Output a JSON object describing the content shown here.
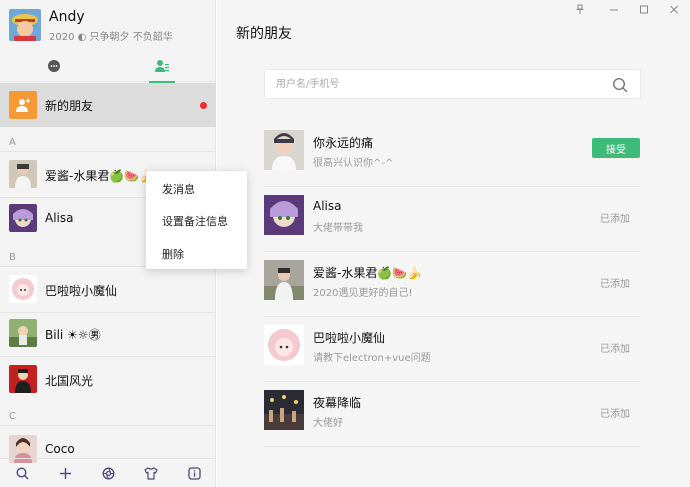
{
  "profile": {
    "name": "Andy",
    "subtitle": "2020 ◐ 只争朝夕 不负韶华"
  },
  "tabs": [
    {
      "icon": "chat-bubble-icon"
    },
    {
      "icon": "contacts-icon"
    }
  ],
  "new_friends": {
    "label": "新的朋友"
  },
  "sections": {
    "a": "A",
    "b": "B",
    "c": "C"
  },
  "contacts": [
    {
      "name": "爱酱-水果君",
      "emoji": "🍏🍉🍌"
    },
    {
      "name": "Alisa"
    },
    {
      "name": "巴啦啦小魔仙"
    },
    {
      "name": "Bili ☀☼㊚"
    },
    {
      "name": "北国风光"
    },
    {
      "name": "Coco"
    }
  ],
  "context_menu": {
    "items": [
      "发消息",
      "设置备注信息",
      "删除"
    ]
  },
  "main": {
    "title": "新的朋友",
    "search_placeholder": "用户名/手机号"
  },
  "requests": [
    {
      "name": "你永远的痛",
      "message": "很高兴认识你^-^",
      "action": "接受"
    },
    {
      "name": "Alisa",
      "message": "大佬带带我",
      "status": "已添加"
    },
    {
      "name": "爱酱-水果君🍏🍉🍌",
      "message": "2020遇见更好的自己!",
      "status": "已添加"
    },
    {
      "name": "巴啦啦小魔仙",
      "message": "请教下electron+vue问题",
      "status": "已添加"
    },
    {
      "name": "夜幕降临",
      "message": "大佬好",
      "status": "已添加"
    }
  ],
  "colors": {
    "accent": "#3dbb78",
    "new_friend_icon": "#f79a36",
    "unread_dot": "#ef2b2b"
  }
}
